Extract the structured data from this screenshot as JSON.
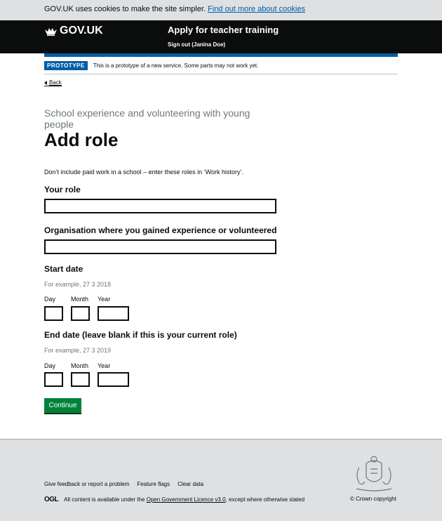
{
  "cookie_banner": {
    "text": "GOV.UK uses cookies to make the site simpler.",
    "link": "Find out more about cookies"
  },
  "header": {
    "logo_text": "GOV.UK",
    "service_name": "Apply for teacher training",
    "signout": "Sign out (Janina Doe)"
  },
  "phase_banner": {
    "tag": "PROTOTYPE",
    "text": "This is a prototype of a new service. Some parts may not work yet."
  },
  "back_link": "Back",
  "caption": "School experience and volunteering with young people",
  "title": "Add role",
  "intro": "Don’t include paid work in a school – enter these roles in ‘Work history’.",
  "form": {
    "role_label": "Your role",
    "role_value": "",
    "organisation_label": "Organisation where you gained experience or volunteered",
    "organisation_value": "",
    "start_date": {
      "label": "Start date",
      "hint": "For example, 27 3 2018",
      "day_label": "Day",
      "month_label": "Month",
      "year_label": "Year"
    },
    "end_date": {
      "label": "End date (leave blank if this is your current role)",
      "hint": "For example, 27 3 2019",
      "day_label": "Day",
      "month_label": "Month",
      "year_label": "Year"
    },
    "continue_label": "Continue"
  },
  "footer": {
    "links": [
      "Give feedback or report a problem",
      "Feature flags",
      "Clear data"
    ],
    "ogl_logo": "OGL",
    "licence_prefix": "All content is available under the",
    "licence_link": "Open Government Licence v3.0",
    "licence_suffix": ", except where otherwise stated",
    "copyright": "© Crown copyright"
  },
  "colors": {
    "header_bg": "#0b0c0c",
    "brand_blue": "#005ea5",
    "button_green": "#00823b",
    "footer_bg": "#dee0e2"
  }
}
